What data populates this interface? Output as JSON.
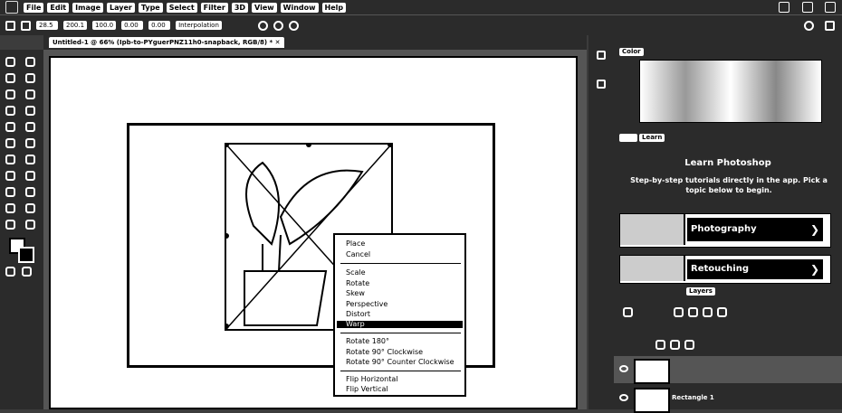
{
  "menubar": {
    "items": [
      "File",
      "Edit",
      "Image",
      "Layer",
      "Type",
      "Select",
      "Filter",
      "3D",
      "View",
      "Window",
      "Help"
    ]
  },
  "options_bar": {
    "fields": [
      "28.5",
      "200.1",
      "100.0",
      "0.00",
      "0.00",
      "Interpolation"
    ]
  },
  "document": {
    "tab_label": "Untitled-1 @ 66% (Ipb-to-PYguerPNZ11h0-snapback, RGB/8) *"
  },
  "context_menu": {
    "items": [
      "Place",
      "Cancel",
      "Scale",
      "Rotate",
      "Skew",
      "Perspective",
      "Distort",
      "Warp",
      "Rotate 180°",
      "Rotate 90° Clockwise",
      "Rotate 90° Counter Clockwise",
      "Flip Horizontal",
      "Flip Vertical"
    ],
    "highlighted": "Warp"
  },
  "panels": {
    "color_tab": "Color",
    "learn_tab": "Learn",
    "learn_title": "Learn Photoshop",
    "learn_desc": "Step-by-step tutorials directly in the app. Pick a topic below to begin.",
    "cards": [
      "Photography",
      "Retouching"
    ],
    "layers_tab": "Layers",
    "layer_name": "Rectangle 1"
  }
}
